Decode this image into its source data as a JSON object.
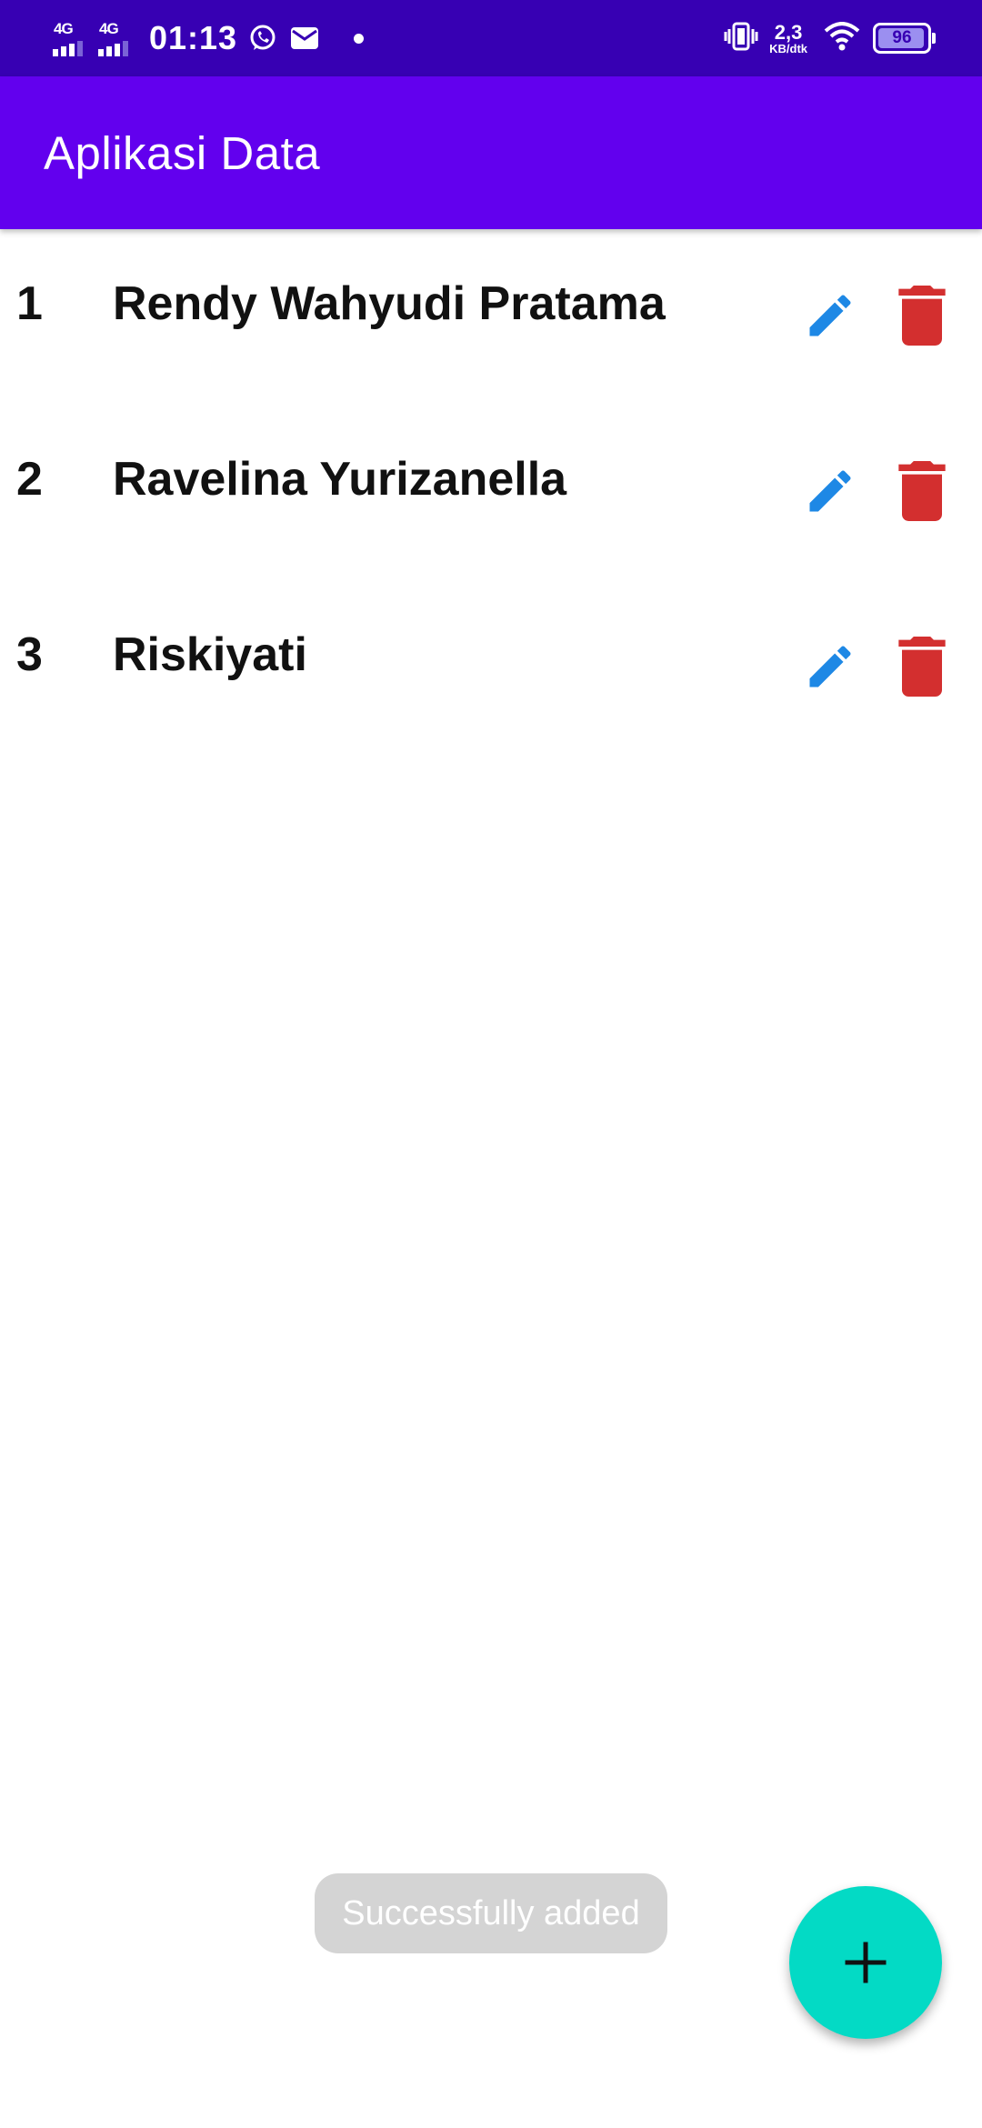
{
  "status_bar": {
    "sim1_label": "4G",
    "sim2_label": "4G",
    "time": "01:13",
    "notification_icons": [
      "whatsapp-icon",
      "mail-icon"
    ],
    "net_speed_value": "2,3",
    "net_speed_unit": "KB/dtk",
    "battery_percent": "96",
    "battery_level": 0.96
  },
  "app_bar": {
    "title": "Aplikasi Data"
  },
  "list": {
    "items": [
      {
        "number": "1",
        "name": "Rendy Wahyudi Pratama"
      },
      {
        "number": "2",
        "name": "Ravelina Yurizanella"
      },
      {
        "number": "3",
        "name": "Riskiyati"
      }
    ]
  },
  "toast": {
    "message": "Successfully added"
  },
  "colors": {
    "status_bar": "#3700b3",
    "app_bar": "#6200ee",
    "edit_icon": "#1e88e5",
    "delete_icon": "#d32f2f",
    "fab": "#03dac5",
    "toast": "#d4d4d4"
  },
  "icons": {
    "edit": "pencil-icon",
    "delete": "trash-icon",
    "fab": "plus-icon"
  }
}
